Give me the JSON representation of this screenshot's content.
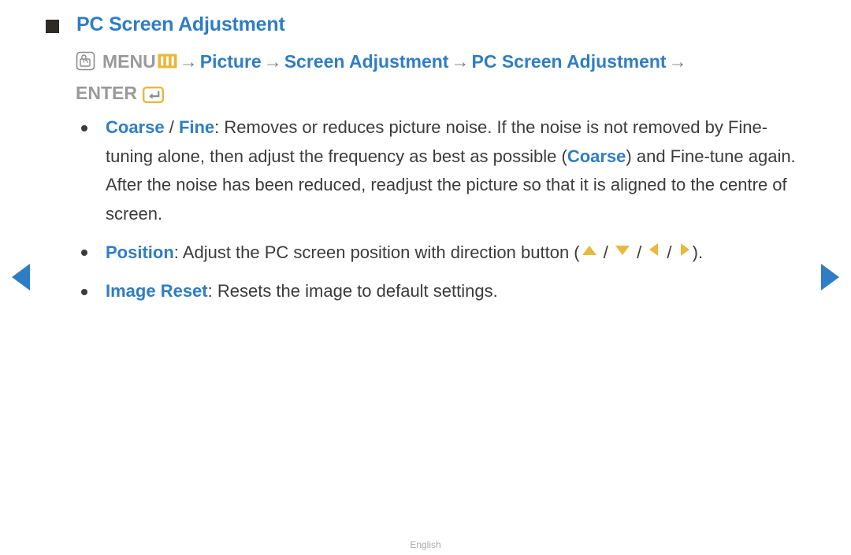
{
  "page": {
    "title": "PC Screen Adjustment",
    "footer_language": "English",
    "accent_blue": "#2f7dc4",
    "gold": "#e8b93c",
    "body_gray": "#3b3b3b",
    "menu_gray": "#9a9a9a"
  },
  "menu_path": {
    "hand_icon": "hand-press-icon",
    "menu_label": "MENU",
    "menu_icon": "menu-bars-icon",
    "arrow": "→",
    "steps": [
      "Picture",
      "Screen Adjustment",
      "PC Screen Adjustment"
    ],
    "enter_label": "ENTER",
    "enter_icon": "enter-return-icon"
  },
  "bullets": [
    {
      "id": "coarse-fine",
      "keyword1": "Coarse",
      "separator": " / ",
      "keyword2": "Fine",
      "text_part1": ": Removes or reduces picture noise. If the noise is not removed by Fine-tuning alone, then adjust the frequency as best as possible (",
      "inline_keyword": "Coarse",
      "text_part2": ") and Fine-tune again. After the noise has been reduced, readjust the picture so that it is aligned to the centre of screen."
    },
    {
      "id": "position",
      "keyword": "Position",
      "text_before": ": Adjust the PC screen position with direction button (",
      "arrows": [
        {
          "name": "arrow-up-icon",
          "dir": "up"
        },
        {
          "name": "arrow-down-icon",
          "dir": "down"
        },
        {
          "name": "arrow-left-icon",
          "dir": "left"
        },
        {
          "name": "arrow-right-icon",
          "dir": "right"
        }
      ],
      "arrow_separator": " / ",
      "text_after": ")."
    },
    {
      "id": "image-reset",
      "keyword": "Image Reset",
      "text": ": Resets the image to default settings."
    }
  ],
  "navigation": {
    "prev_label": "previous-page-arrow",
    "next_label": "next-page-arrow"
  }
}
